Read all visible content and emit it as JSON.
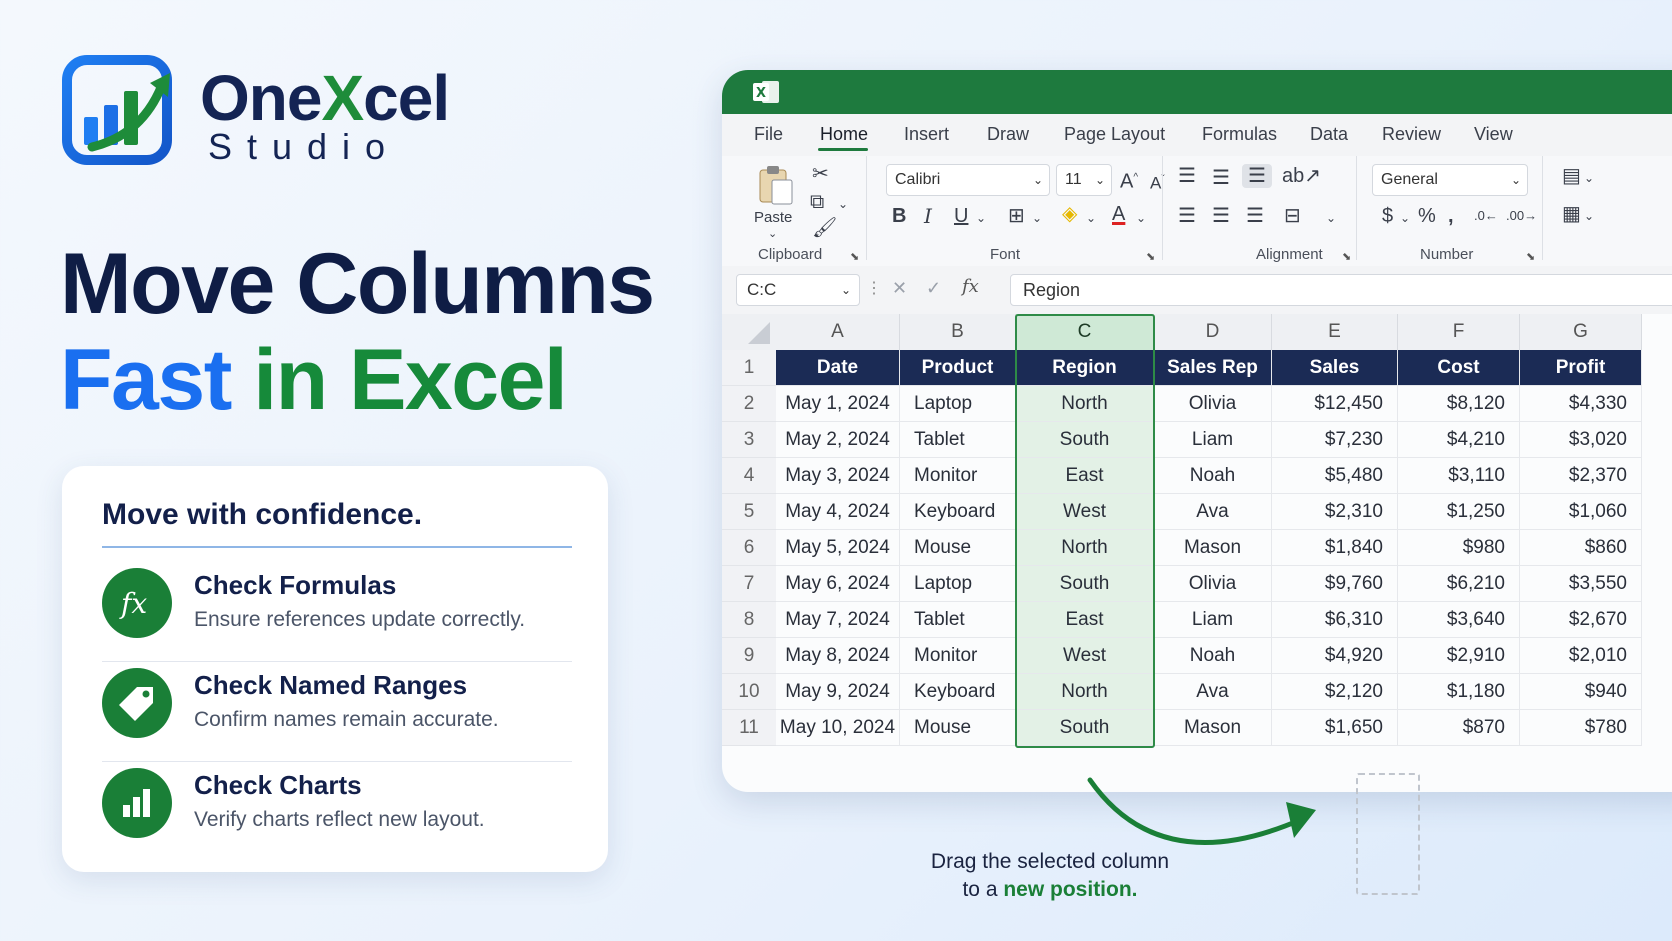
{
  "brand": {
    "name_part1": "One",
    "name_x": "X",
    "name_part2": "cel",
    "sub": "Studio"
  },
  "headline": {
    "line1": "Move Columns",
    "line2a": "Fast",
    "line2b": "in Excel"
  },
  "card": {
    "title": "Move with confidence.",
    "tips": [
      {
        "icon": "fx-icon",
        "title": "Check Formulas",
        "desc": "Ensure references update correctly."
      },
      {
        "icon": "tag-icon",
        "title": "Check Named Ranges",
        "desc": "Confirm names remain accurate."
      },
      {
        "icon": "bar-chart-icon",
        "title": "Check Charts",
        "desc": "Verify charts reflect new layout."
      }
    ]
  },
  "excel": {
    "tabs": [
      "File",
      "Home",
      "Insert",
      "Draw",
      "Page Layout",
      "Formulas",
      "Data",
      "Review",
      "View"
    ],
    "active_tab": "Home",
    "ribbon": {
      "paste_label": "Paste",
      "groups": [
        "Clipboard",
        "Font",
        "Alignment",
        "Number"
      ],
      "font_name": "Calibri",
      "font_size": "11",
      "number_format": "General"
    },
    "name_box": "C:C",
    "formula_bar_value": "Region",
    "columns": [
      "A",
      "B",
      "C",
      "D",
      "E",
      "F",
      "G"
    ],
    "selected_column": "C",
    "header_row": [
      "Date",
      "Product",
      "Region",
      "Sales Rep",
      "Sales",
      "Cost",
      "Profit"
    ],
    "rows": [
      [
        "May 1, 2024",
        "Laptop",
        "North",
        "Olivia",
        "$12,450",
        "$8,120",
        "$4,330"
      ],
      [
        "May 2, 2024",
        "Tablet",
        "South",
        "Liam",
        "$7,230",
        "$4,210",
        "$3,020"
      ],
      [
        "May 3, 2024",
        "Monitor",
        "East",
        "Noah",
        "$5,480",
        "$3,110",
        "$2,370"
      ],
      [
        "May 4, 2024",
        "Keyboard",
        "West",
        "Ava",
        "$2,310",
        "$1,250",
        "$1,060"
      ],
      [
        "May 5, 2024",
        "Mouse",
        "North",
        "Mason",
        "$1,840",
        "$980",
        "$860"
      ],
      [
        "May 6, 2024",
        "Laptop",
        "South",
        "Olivia",
        "$9,760",
        "$6,210",
        "$3,550"
      ],
      [
        "May 7, 2024",
        "Tablet",
        "East",
        "Liam",
        "$6,310",
        "$3,640",
        "$2,670"
      ],
      [
        "May 8, 2024",
        "Monitor",
        "West",
        "Noah",
        "$4,920",
        "$2,910",
        "$2,010"
      ],
      [
        "May 9, 2024",
        "Keyboard",
        "North",
        "Ava",
        "$2,120",
        "$1,180",
        "$940"
      ],
      [
        "May 10, 2024",
        "Mouse",
        "South",
        "Mason",
        "$1,650",
        "$870",
        "$780"
      ]
    ],
    "row_numbers": [
      "1",
      "2",
      "3",
      "4",
      "5",
      "6",
      "7",
      "8",
      "9",
      "10",
      "11"
    ]
  },
  "drag_hint": {
    "line1": "Drag the selected column",
    "line2_prefix": "to a",
    "line2_highlight": "new position."
  },
  "colors": {
    "excel_green": "#1e7a3e",
    "header_navy": "#1b2b55",
    "accent_blue": "#1a6ff0",
    "accent_green": "#168a3a"
  }
}
